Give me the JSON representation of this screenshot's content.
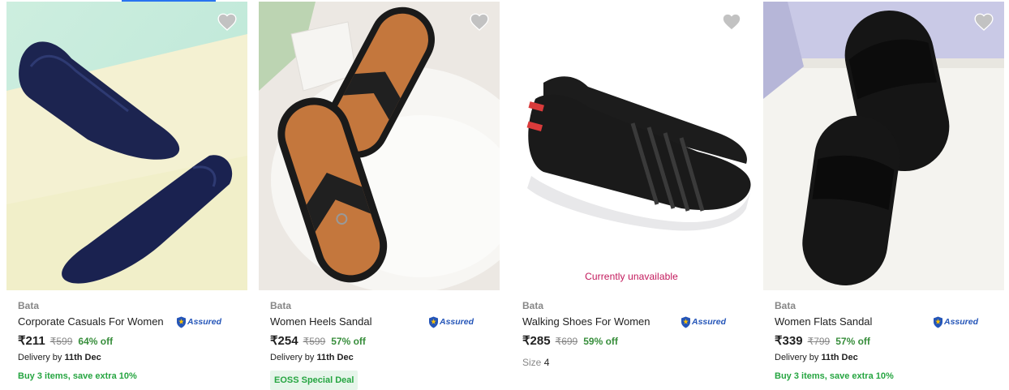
{
  "products": [
    {
      "brand": "Bata",
      "title": "Corporate Casuals For Women",
      "assured_label": "Assured",
      "price": "₹211",
      "mrp": "₹599",
      "discount": "64% off",
      "delivery_prefix": "Delivery by",
      "delivery_date": "11th Dec",
      "offer": "Buy 3 items, save extra 10%",
      "image_icon": "navy-ballet-flats-image"
    },
    {
      "brand": "Bata",
      "title": "Women Heels Sandal",
      "assured_label": "Assured",
      "price": "₹254",
      "mrp": "₹599",
      "discount": "57% off",
      "delivery_prefix": "Delivery by",
      "delivery_date": "11th Dec",
      "deal_badge": "EOSS Special Deal",
      "image_icon": "black-tan-sandals-image"
    },
    {
      "brand": "Bata",
      "title": "Walking Shoes For Women",
      "assured_label": "Assured",
      "price": "₹285",
      "mrp": "₹699",
      "discount": "59% off",
      "size_label": "Size",
      "size_value": "4",
      "status": "Currently unavailable",
      "image_icon": "black-walking-shoes-image"
    },
    {
      "brand": "Bata",
      "title": "Women Flats Sandal",
      "assured_label": "Assured",
      "price": "₹339",
      "mrp": "₹799",
      "discount": "57% off",
      "delivery_prefix": "Delivery by",
      "delivery_date": "11th Dec",
      "offer": "Buy 3 items, save extra 10%",
      "image_icon": "black-flat-mules-image"
    }
  ],
  "colors": {
    "discount_green": "#388e3c",
    "offer_green": "#26a541",
    "unavailable_pink": "#c2185b",
    "assured_blue": "#2455b8",
    "wishlist_gray": "#c2c2c2"
  }
}
